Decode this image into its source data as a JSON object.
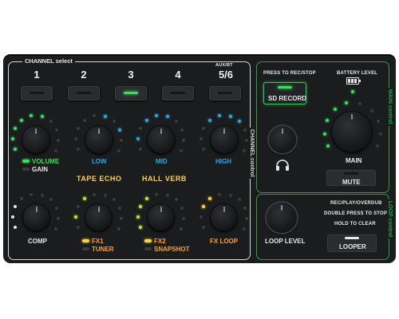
{
  "colors": {
    "accent_green": "#35e05a",
    "accent_blue": "#2aa7e0",
    "accent_yellow": "#ffd23c",
    "accent_orange": "#ffa21f",
    "panel": "#1b1c1e"
  },
  "channel": {
    "section_title": "CHANNEL select",
    "numbers": [
      "1",
      "2",
      "3",
      "4",
      "5/6"
    ],
    "aux_label": "AUX/BT",
    "vertical_label": "CHANNEL control",
    "active_channel_index": 2
  },
  "knobs_top": {
    "volume": "VOLUME",
    "gain": "GAIN",
    "low": "LOW",
    "mid": "MID",
    "high": "HIGH"
  },
  "effects": {
    "tape_echo": "TAPE ECHO",
    "hall_verb": "HALL VERB"
  },
  "knobs_bottom": {
    "comp": "COMP",
    "fx1": "FX1",
    "tuner": "TUNER",
    "fx2": "FX2",
    "snapshot": "SNAPSHOT",
    "fx_loop": "FX LOOP"
  },
  "main": {
    "press_label": "PRESS TO REC/STOP",
    "sd_record": "SD RECORD",
    "battery_level": "BATTERY LEVEL",
    "main_label": "MAIN",
    "mute": "MUTE",
    "vertical_label": "MAIN control",
    "headphones_icon": "headphones-icon"
  },
  "loop": {
    "loop_level": "LOOP LEVEL",
    "line1": "REC/PLAY/OVERDUB",
    "line2": "DOUBLE PRESS TO STOP",
    "line3": "HOLD TO CLEAR",
    "looper": "LOOPER",
    "vertical_label": "LOOP control"
  }
}
